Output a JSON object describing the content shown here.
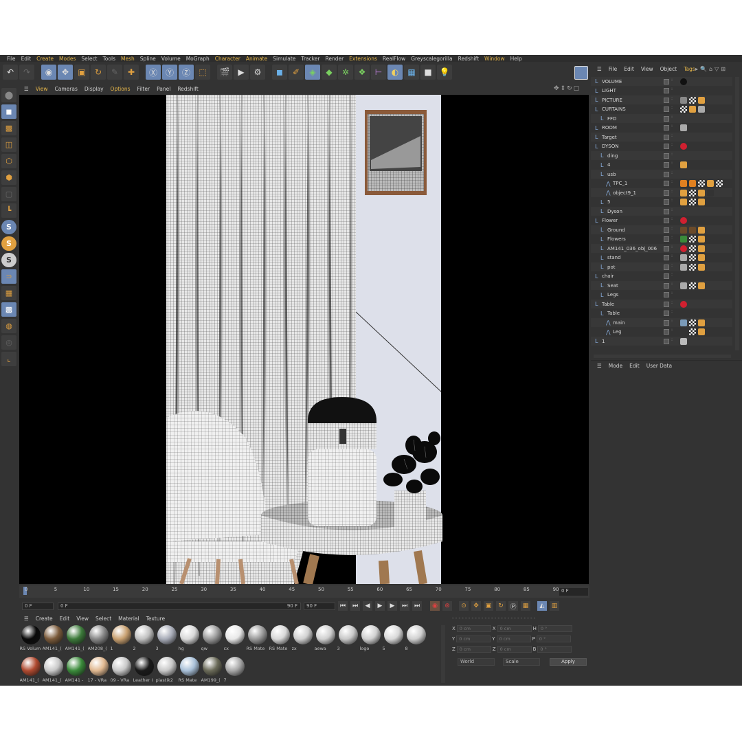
{
  "menubar": [
    "File",
    "Edit",
    "Create",
    "Modes",
    "Select",
    "Tools",
    "Mesh",
    "Spline",
    "Volume",
    "MoGraph",
    "Character",
    "Animate",
    "Simulate",
    "Tracker",
    "Render",
    "Extensions",
    "RealFlow",
    "Greyscalegorilla",
    "Redshift",
    "Window",
    "Help"
  ],
  "viewport_menu": [
    "View",
    "Cameras",
    "Display",
    "Options",
    "Filter",
    "Panel",
    "Redshift"
  ],
  "objmgr_menu": [
    "File",
    "Edit",
    "View",
    "Object",
    "Tags"
  ],
  "objects": [
    {
      "name": "VOLUME",
      "tags": [
        "black"
      ]
    },
    {
      "name": "LIGHT",
      "tags": []
    },
    {
      "name": "PICTURE",
      "tags": [
        "img",
        "check",
        "dots"
      ]
    },
    {
      "name": "CURTAINS",
      "tags": [
        "check",
        "dots",
        "grey"
      ]
    },
    {
      "name": "FFD",
      "tags": []
    },
    {
      "name": "ROOM",
      "tags": [
        "grey"
      ]
    },
    {
      "name": "Target",
      "tags": []
    },
    {
      "name": "DYSON",
      "tags": [
        "red"
      ]
    },
    {
      "name": "ding",
      "tags": []
    },
    {
      "name": "4",
      "tags": [
        "dots"
      ]
    },
    {
      "name": "usb",
      "tags": []
    },
    {
      "name": "TPC_1",
      "tags": [
        "tri",
        "tri",
        "check",
        "dots",
        "check"
      ]
    },
    {
      "name": "object9_1",
      "tags": [
        "dots",
        "check",
        "dots",
        "dark"
      ]
    },
    {
      "name": "5",
      "tags": [
        "dots",
        "check",
        "dots"
      ]
    },
    {
      "name": "Dyson",
      "tags": []
    },
    {
      "name": "Flower",
      "tags": [
        "red"
      ]
    },
    {
      "name": "Ground",
      "tags": [
        "brown",
        "brown",
        "dots"
      ]
    },
    {
      "name": "Flowers",
      "tags": [
        "green",
        "check",
        "dots"
      ]
    },
    {
      "name": "AM141_036_obj_006",
      "tags": [
        "red",
        "check",
        "dots"
      ]
    },
    {
      "name": "stand",
      "tags": [
        "grey",
        "check",
        "dots"
      ]
    },
    {
      "name": "pot",
      "tags": [
        "grey",
        "check",
        "dots"
      ]
    },
    {
      "name": "chair",
      "tags": []
    },
    {
      "name": "Seat",
      "tags": [
        "grey",
        "check",
        "dots"
      ]
    },
    {
      "name": "Legs",
      "tags": []
    },
    {
      "name": "Table",
      "tags": [
        "red"
      ]
    },
    {
      "name": "Table",
      "tags": []
    },
    {
      "name": "main",
      "tags": [
        "blue",
        "check",
        "dots"
      ]
    },
    {
      "name": "Leg",
      "tags": [
        "dark",
        "check",
        "dots"
      ]
    },
    {
      "name": "1",
      "tags": [
        "cam"
      ]
    }
  ],
  "attr_menu": [
    "Mode",
    "Edit",
    "User Data"
  ],
  "timeline": {
    "ticks": [
      "0",
      "5",
      "10",
      "15",
      "20",
      "25",
      "30",
      "35",
      "40",
      "45",
      "50",
      "55",
      "60",
      "65",
      "70",
      "75",
      "80",
      "85",
      "90"
    ],
    "current": "0 F"
  },
  "playbar": {
    "start": "0 F",
    "range_start": "0 F",
    "range_end": "90 F",
    "end": "90 F"
  },
  "mat_menu": [
    "Create",
    "Edit",
    "View",
    "Select",
    "Material",
    "Texture"
  ],
  "materials": [
    {
      "label": "RS Volum",
      "color": "#0a0a0a"
    },
    {
      "label": "AM141_(",
      "color": "#7a5a3a"
    },
    {
      "label": "AM141_(",
      "color": "#3c7a3a"
    },
    {
      "label": "AM208_(",
      "color": "#888888"
    },
    {
      "label": "1",
      "color": "#c8a070"
    },
    {
      "label": "2",
      "color": "#c0c0c0"
    },
    {
      "label": "3",
      "color": "#a8acb8"
    },
    {
      "label": "hg",
      "color": "#d8d8d8"
    },
    {
      "label": "qw",
      "color": "#9a9a9a"
    },
    {
      "label": "cx",
      "color": "#e8e8e8"
    },
    {
      "label": "RS Mate",
      "color": "#9a9a9a"
    },
    {
      "label": "RS Mate",
      "color": "#d8d8d8"
    },
    {
      "label": "zx",
      "color": "#d0d0d0"
    },
    {
      "label": "aewa",
      "color": "#d0d0d0"
    },
    {
      "label": "3",
      "color": "#c8c8c8"
    },
    {
      "label": "logo",
      "color": "#d0d0d0"
    },
    {
      "label": "5",
      "color": "#d8d8d8"
    },
    {
      "label": "8",
      "color": "#d0d0d0"
    },
    {
      "label": "AM141_(",
      "color": "#b04a30"
    },
    {
      "label": "AM141_(",
      "color": "#c8c8c8"
    },
    {
      "label": "AM141 -",
      "color": "#3a8a3a"
    },
    {
      "label": "17 - VRa",
      "color": "#e0b890"
    },
    {
      "label": "09 - VRa",
      "color": "#c8c8c8"
    },
    {
      "label": "Leather I",
      "color": "#1a1a1a"
    },
    {
      "label": "plastik2",
      "color": "#c8c8c8"
    },
    {
      "label": "RS Mate",
      "color": "#a8c0d8"
    },
    {
      "label": "AM199_(",
      "color": "#6a6a58"
    },
    {
      "label": "7",
      "color": "#a8a8a8"
    }
  ],
  "coords": {
    "rows": [
      {
        "a": "X",
        "av": "0 cm",
        "b": "X",
        "bv": "0 cm",
        "c": "H",
        "cv": "0 °"
      },
      {
        "a": "Y",
        "av": "0 cm",
        "b": "Y",
        "bv": "0 cm",
        "c": "P",
        "cv": "0 °"
      },
      {
        "a": "Z",
        "av": "0 cm",
        "b": "Z",
        "bv": "0 cm",
        "c": "B",
        "cv": "0 °"
      }
    ],
    "world": "World",
    "scale": "Scale",
    "apply": "Apply"
  },
  "colors": {
    "accent": "#e8b84a",
    "selected": "#6b87b3",
    "bg": "#333333"
  }
}
